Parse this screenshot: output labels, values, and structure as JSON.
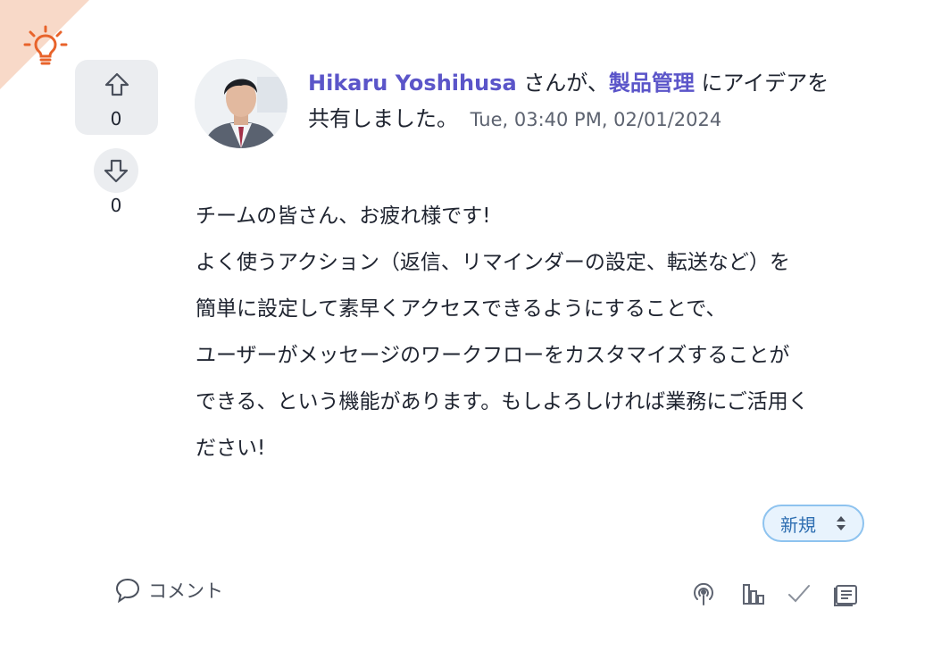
{
  "post": {
    "category_icon": "lightbulb-icon",
    "author": "Hikaru Yoshihusa",
    "text_1": "さんが、",
    "product": "製品管理",
    "text_2": "にアイデアを",
    "text_3": "共有しました。",
    "timestamp": "Tue, 03:40 PM, 02/01/2024",
    "body": {
      "greeting": "チームの皆さん、お疲れ様です!",
      "lines": [
        "よく使うアクション（返信、リマインダーの設定、転送など）を",
        "簡単に設定して素早くアクセスできるようにすることで、",
        "ユーザーがメッセージのワークフローをカスタマイズすることが",
        "できる、という機能があります。もしよろしければ業務にご活用く",
        "ださい!"
      ]
    },
    "status": "新規"
  },
  "votes": {
    "up": "0",
    "down": "0"
  },
  "footer": {
    "comment_label": "コメント",
    "icons": [
      "podcast-icon",
      "bar-chart-icon",
      "check-icon",
      "notes-icon"
    ]
  },
  "colors": {
    "accent": "#5b55c9",
    "badge": "#f8d9c8",
    "bulb": "#e8632b",
    "status_border": "#8ec3ef"
  }
}
